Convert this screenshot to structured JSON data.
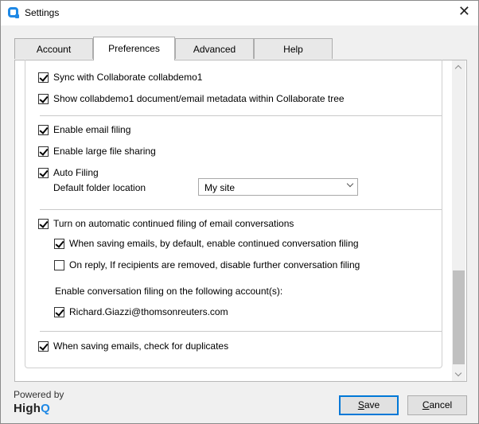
{
  "window": {
    "title": "Settings",
    "close_glyph": "✕"
  },
  "tabs": [
    {
      "label": "Account",
      "active": false
    },
    {
      "label": "Preferences",
      "active": true
    },
    {
      "label": "Advanced",
      "active": false
    },
    {
      "label": "Help",
      "active": false
    }
  ],
  "preferences": {
    "sync_collaborate": {
      "label": "Sync with Collaborate collabdemo1",
      "checked": true
    },
    "show_metadata": {
      "label": "Show collabdemo1 document/email metadata within Collaborate tree",
      "checked": true
    },
    "enable_email_filing": {
      "label": "Enable email filing",
      "checked": true
    },
    "enable_large_file_sharing": {
      "label": "Enable large file sharing",
      "checked": true
    },
    "auto_filing": {
      "label": "Auto Filing",
      "checked": true
    },
    "default_folder": {
      "label": "Default folder location",
      "value": "My site"
    },
    "continued_filing": {
      "label": "Turn on automatic continued filing of email conversations",
      "checked": true
    },
    "enable_continued_on_save": {
      "label": "When saving emails, by default, enable continued conversation filing",
      "checked": true
    },
    "disable_on_reply": {
      "label": "On reply, If recipients are removed, disable further conversation filing",
      "checked": false
    },
    "accounts_heading": "Enable conversation filing on the following account(s):",
    "account": {
      "label": "Richard.Giazzi@thomsonreuters.com",
      "checked": true
    },
    "check_duplicates": {
      "label": "When saving emails, check for duplicates",
      "checked": true
    }
  },
  "footer": {
    "powered_by": "Powered by",
    "logo_text": "High",
    "logo_q": "Q",
    "save_first": "S",
    "save_rest": "ave",
    "cancel_first": "C",
    "cancel_rest": "ancel"
  },
  "colors": {
    "accent": "#1e88e5",
    "default_button_border": "#0078d7"
  },
  "icons": {
    "app": "highq-q-icon",
    "close": "close-icon",
    "dropdown": "chevron-down-icon"
  }
}
